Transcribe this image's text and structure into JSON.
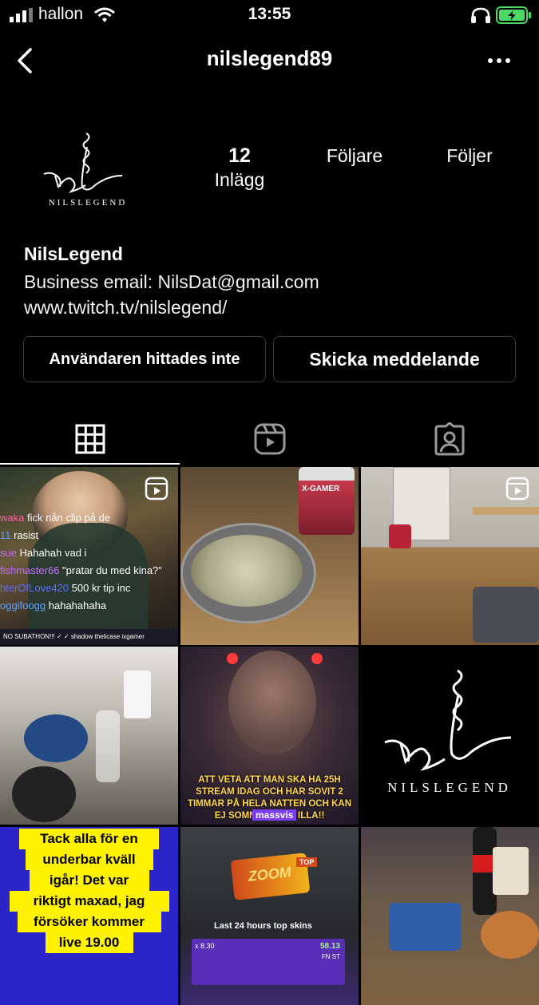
{
  "status_bar": {
    "carrier": "hallon",
    "time": "13:55"
  },
  "nav": {
    "username": "nilslegend89"
  },
  "profile": {
    "logo_text": "NILSLEGEND",
    "stats": [
      {
        "number": "12",
        "label": "Inlägg"
      },
      {
        "number": "",
        "label": "Följare"
      },
      {
        "number": "",
        "label": "Följer"
      }
    ],
    "name": "NilsLegend",
    "bio": "Business email: NilsDat@gmail.com",
    "link": "www.twitch.tv/nilslegend/"
  },
  "buttons": {
    "user_not_found": "Användaren hittades inte",
    "send_message": "Skicka meddelande"
  },
  "tabs": [
    {
      "icon": "grid-icon"
    },
    {
      "icon": "reels-icon"
    },
    {
      "icon": "tagged-icon"
    }
  ],
  "posts": {
    "p1": {
      "chat": [
        {
          "user": "waka",
          "text": "fick nån clip på de"
        },
        {
          "user": "11",
          "text": "rasist"
        },
        {
          "user": "sue",
          "text": "Hahahah vad i"
        },
        {
          "user": "fishmaster66",
          "text": "\"pratar du med kina?\""
        },
        {
          "user": "hterOfLove420",
          "text": "500 kr tip inc"
        },
        {
          "user": "oggifoogg",
          "text": "hahahahaha"
        }
      ],
      "footer": "NO SUBATHON!!! ✓ ✓    shadow thelicase ixgamer"
    },
    "p3_energy": "X-GAMER",
    "p5_caption": "ATT VETA ATT MAN SKA HA 25H STREAM IDAG OCH HAR SOVIT 2 TIMMAR PÅ HELA NATTEN OCH KAN EJ SOMNA OM ÄR ILLA!!",
    "p5_sub": "massvis",
    "p6_logo": "NILSLEGEND",
    "p7_text": [
      "Tack alla för en",
      "underbar kväll",
      "igår! Det var",
      "riktigt maxad, jag",
      "försöker kommer",
      "live 19.00"
    ],
    "p8": {
      "badge": "ZOOM",
      "top": "TOP",
      "caption": "Last 24 hours top skins",
      "multiplier": "x 8.30",
      "price": "58.13",
      "tag": "FN ST"
    }
  }
}
